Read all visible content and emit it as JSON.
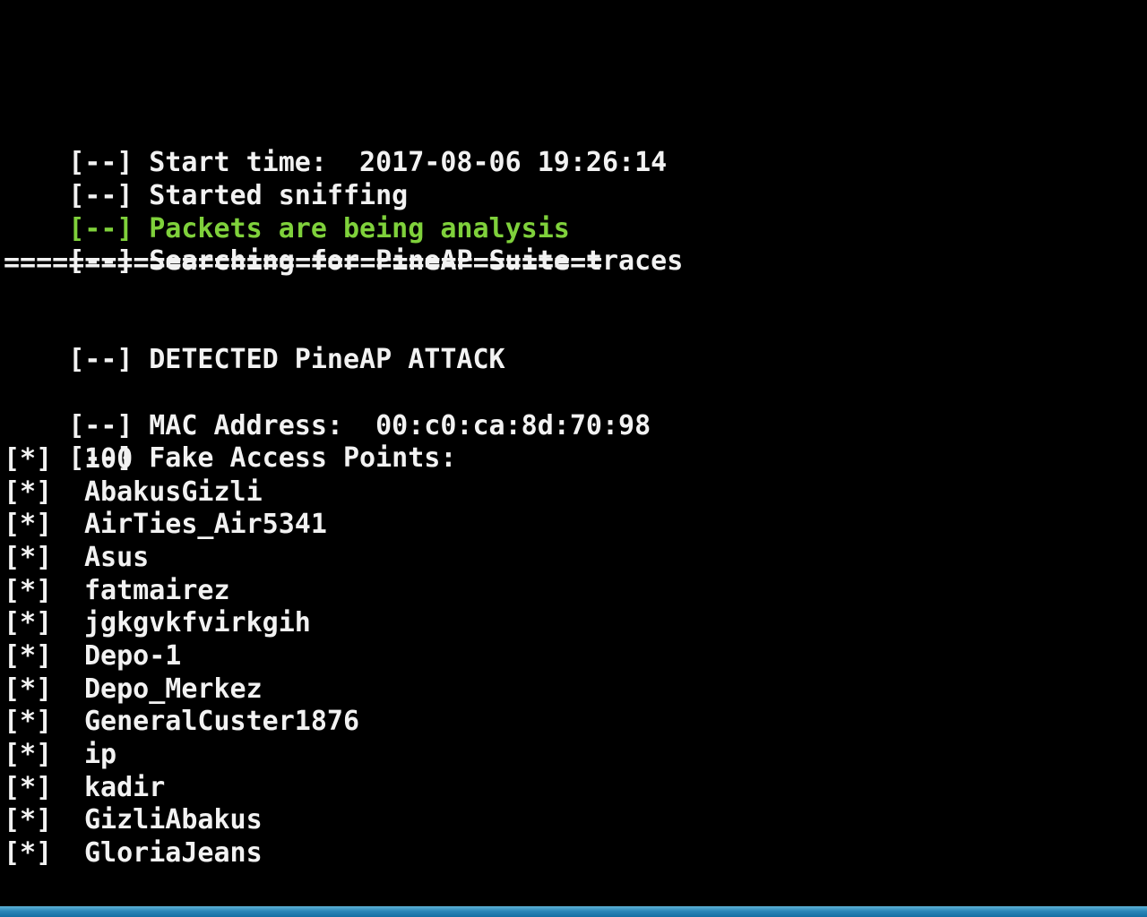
{
  "terminal": {
    "top_rule": "-----------------------------------------------------",
    "eq_rule": "=====================================",
    "start_prefix": "[--]",
    "start_text": "Start time:  2017-08-06 19:26:14",
    "sniff_prefix": "[--]",
    "sniff_text": "Started sniffing",
    "analysis_prefix": "[--]",
    "analysis_text": "Packets are being analysis",
    "search_prefix": "[--]",
    "search_text": "Searching for PineAP Suite traces",
    "detected_prefix": "[--]",
    "detected_text": "DETECTED PineAP ATTACK",
    "mac_prefix": "[--]",
    "mac_text": "MAC Address:  00:c0:ca:8d:70:98",
    "fake_prefix": "[--]",
    "fake_text": "Fake Access Points:",
    "ap_marker": "[*]",
    "access_points": [
      "100",
      "AbakusGizli",
      "AirTies_Air5341",
      "Asus",
      "fatmairez",
      "jgkgvkfvirkgih",
      "Depo-1",
      "Depo_Merkez",
      "GeneralCuster1876",
      "ip",
      "kadir",
      "GizliAbakus",
      "GloriaJeans"
    ],
    "colors": {
      "background": "#000000",
      "text": "#f2f2f2",
      "highlight": "#7fd13b",
      "taskbar": "#2a86b8"
    }
  }
}
